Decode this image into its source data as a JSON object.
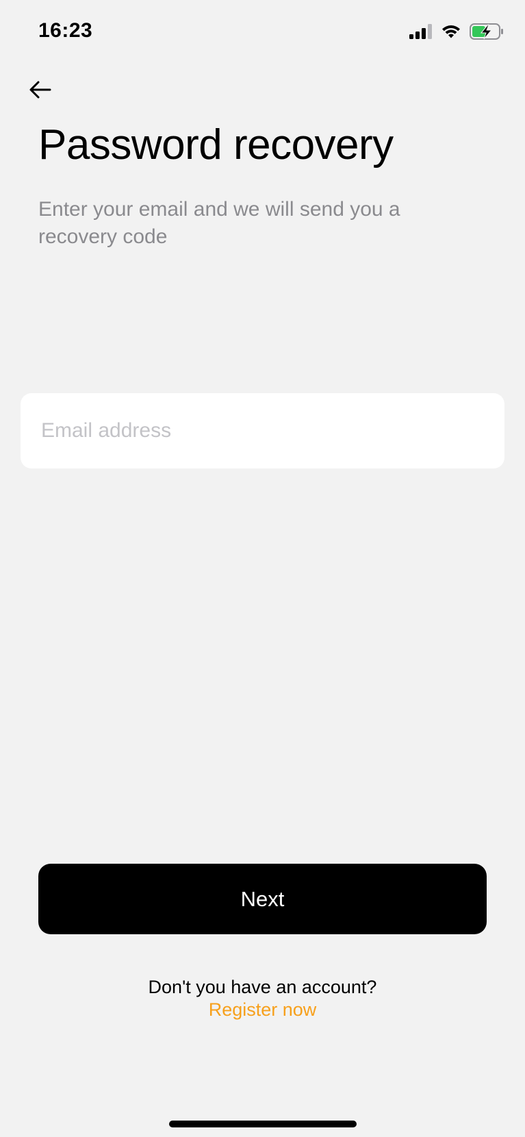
{
  "status_bar": {
    "time": "16:23",
    "icons": [
      "cellular-signal-icon",
      "wifi-icon",
      "battery-charging-icon"
    ]
  },
  "header": {
    "back_icon": "arrow-left-icon",
    "title": "Password recovery",
    "subtitle": "Enter your email and we will send you a recovery code"
  },
  "form": {
    "email_value": "",
    "email_placeholder": "Email address"
  },
  "actions": {
    "next_label": "Next"
  },
  "footer": {
    "prompt": "Don't you have an account?",
    "register_label": "Register now"
  },
  "colors": {
    "background": "#f2f2f2",
    "accent": "#f7a01c",
    "button": "#000000",
    "muted_text": "#8a8a8e",
    "battery": "#34c759"
  }
}
